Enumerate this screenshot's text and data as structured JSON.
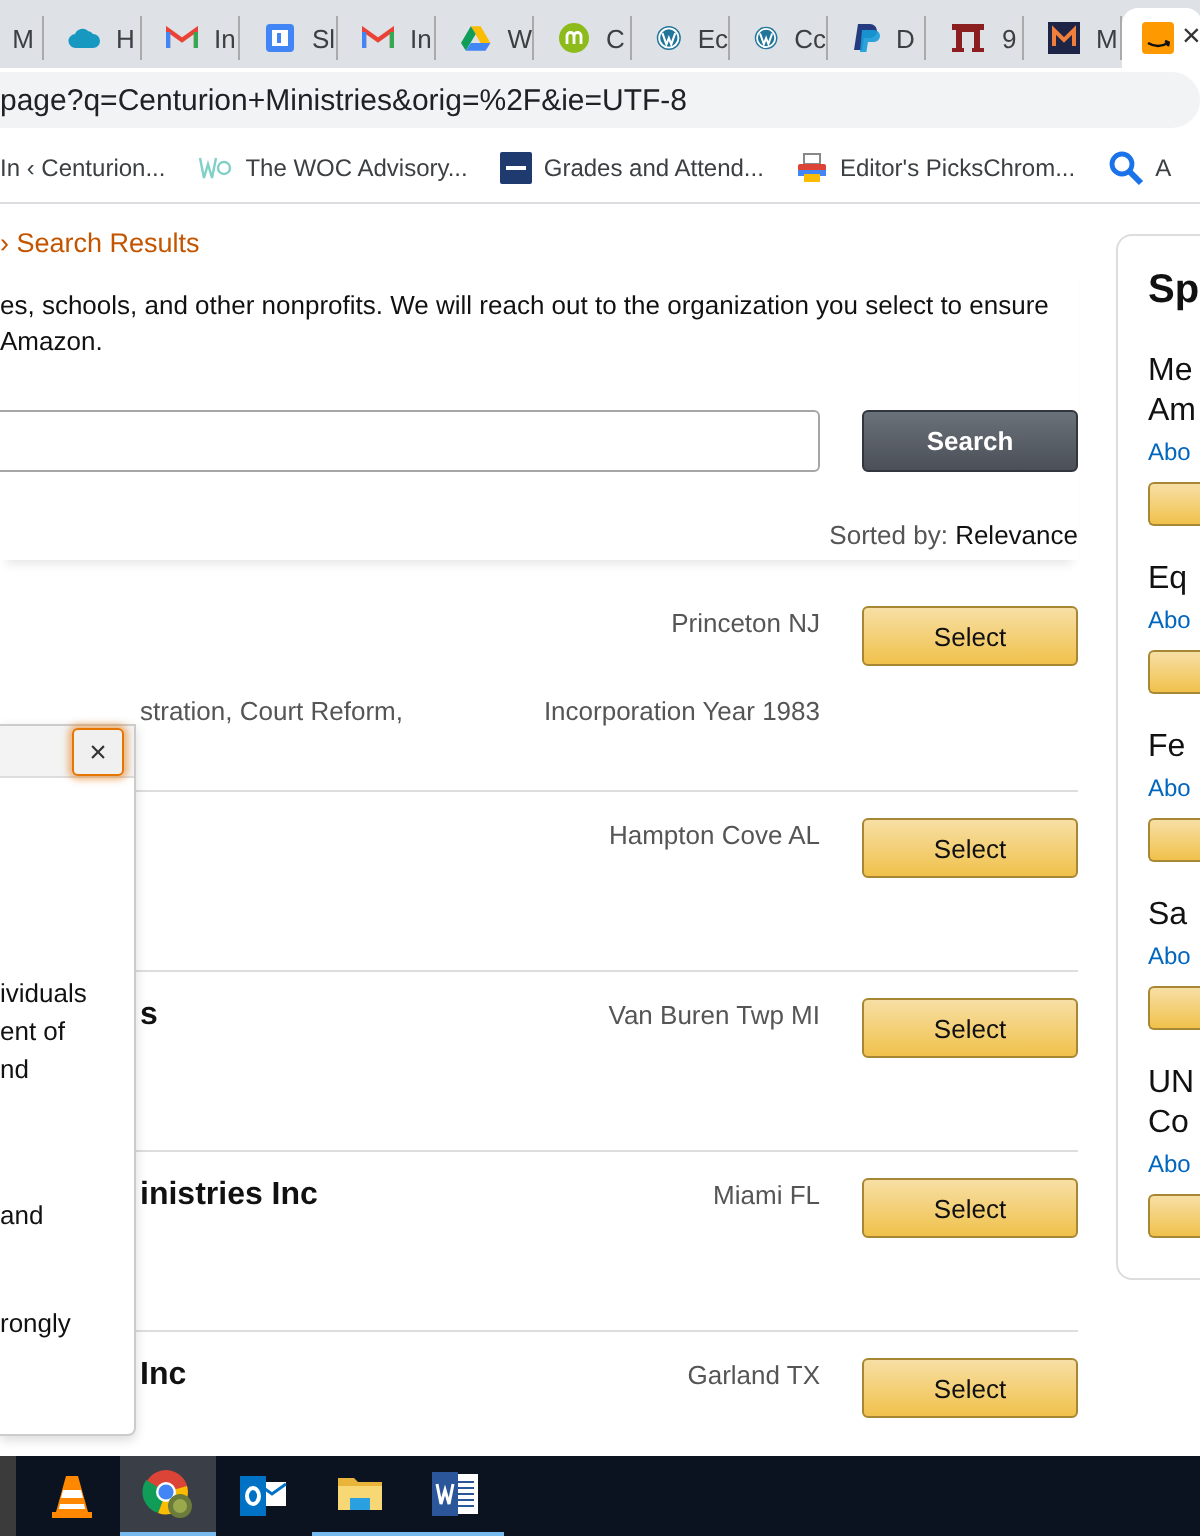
{
  "browser": {
    "tabs": [
      {
        "label": "M",
        "kind": "none",
        "selected": false
      },
      {
        "label": "H",
        "kind": "cloud",
        "selected": false
      },
      {
        "label": "In",
        "kind": "mail",
        "selected": false
      },
      {
        "label": "Sl",
        "kind": "calendar",
        "selected": false
      },
      {
        "label": "In",
        "kind": "mail",
        "selected": false
      },
      {
        "label": "W",
        "kind": "drive",
        "selected": false
      },
      {
        "label": "C",
        "kind": "disc",
        "selected": false
      },
      {
        "label": "Ec",
        "kind": "wordpress",
        "selected": false
      },
      {
        "label": "Cc",
        "kind": "wordpress",
        "selected": false
      },
      {
        "label": "D",
        "kind": "paypal",
        "selected": false
      },
      {
        "label": "9",
        "kind": "columns",
        "selected": false
      },
      {
        "label": "M",
        "kind": "mlogo",
        "selected": false
      },
      {
        "kind": "amazon",
        "selected": true,
        "close": "×"
      }
    ],
    "address": "page?q=Centurion+Ministries&orig=%2F&ie=UTF-8",
    "bookmarks": [
      {
        "label": "In ‹ Centurion...",
        "kind": "none"
      },
      {
        "label": "The WOC Advisory...",
        "kind": "woc"
      },
      {
        "label": "Grades and Attend...",
        "kind": "sis"
      },
      {
        "label": "Editor's PicksChrom...",
        "kind": "picks"
      },
      {
        "label": "A",
        "kind": "search"
      }
    ]
  },
  "page": {
    "breadcrumb": {
      "separator": "›",
      "current": "Search Results"
    },
    "intro": [
      "es, schools, and other nonprofits. We will reach out to the organization you select to ensure",
      "Amazon."
    ],
    "search": {
      "button": "Search"
    },
    "sort": {
      "label": "Sorted by:",
      "value": "Relevance"
    },
    "results": [
      {
        "location": "Princeton NJ",
        "details": "stration, Court Reform,",
        "year": "Incorporation Year 1983",
        "button": "Select"
      },
      {
        "location": "Hampton Cove AL",
        "button": "Select"
      },
      {
        "title": "s",
        "location": "Van Buren Twp MI",
        "button": "Select"
      },
      {
        "title": "inistries Inc",
        "location": "Miami FL",
        "button": "Select"
      },
      {
        "title": "Inc",
        "location": "Garland TX",
        "button": "Select"
      }
    ],
    "popup": {
      "close": "×",
      "paragraphs": [
        [
          "ividuals",
          "ent of",
          "nd"
        ],
        [
          "and"
        ],
        [
          "rongly"
        ]
      ]
    },
    "sidebar": {
      "title": "Sp",
      "items": [
        {
          "lines": [
            "Me",
            "Am"
          ],
          "link": "Abo"
        },
        {
          "lines": [
            "Eq"
          ],
          "link": "Abo"
        },
        {
          "lines": [
            "Fe"
          ],
          "link": "Abo"
        },
        {
          "lines": [
            "Sa"
          ],
          "link": "Abo"
        },
        {
          "lines": [
            "UN",
            "Co"
          ],
          "link": "Abo"
        }
      ]
    }
  },
  "taskbar": [
    {
      "kind": "vlc",
      "selected": false,
      "running": false
    },
    {
      "kind": "chrome",
      "selected": true,
      "running": true
    },
    {
      "kind": "outlook",
      "selected": false,
      "running": false
    },
    {
      "kind": "explorer",
      "selected": false,
      "running": true
    },
    {
      "kind": "word",
      "selected": false,
      "running": true
    }
  ]
}
